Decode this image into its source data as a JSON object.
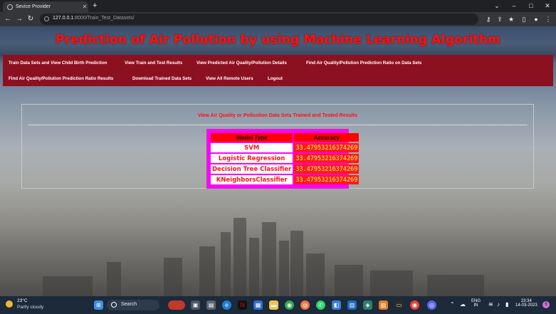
{
  "browser": {
    "tab_title": "Sevice Provider",
    "new_tab": "+",
    "url_host": "127.0.0.1",
    "url_path": ":8000/Train_Test_Datasets/",
    "window_controls": [
      "⌄",
      "–",
      "□",
      "✕"
    ]
  },
  "page": {
    "title": "Prediction of Air Pollution by using Machine Learning Algorithm",
    "menu": [
      "Train Data Sets and View Child Birth Prediction",
      "View Train and Test Results",
      "View Predicted Air Quality/Pollution Details",
      "Find Air Quality/Pollution Prediction Ratio on Data Sets",
      "Find Air Quality/Pollution Prediction Ratio Results",
      "Download Trained Data Sets",
      "View All Remote Users",
      "Logout"
    ],
    "panel_title": "View Air Quality or Pollusiton Data Sets Trained and Tested Results",
    "table": {
      "headers": [
        "Model Type",
        "Accuracy"
      ],
      "rows": [
        [
          "SVM",
          "33.47953216374269"
        ],
        [
          "Logistic Regression",
          "33.47953216374269"
        ],
        [
          "Decision Tree Classifier",
          "33.47953216374269"
        ],
        [
          "KNeighborsClassifier",
          "33.47953216374269"
        ]
      ]
    }
  },
  "taskbar": {
    "temperature": "23°C",
    "weather": "Partly cloudy",
    "search_label": "Search",
    "lang_1": "ENG",
    "lang_2": "IN",
    "time": "23:34",
    "date": "14-03-2023",
    "notification_count": "5"
  },
  "colors": {
    "title_red": "#ff1111",
    "menu_bar": "#8b1121",
    "table_border": "#ff00ff",
    "accuracy_text": "#ffff66"
  }
}
